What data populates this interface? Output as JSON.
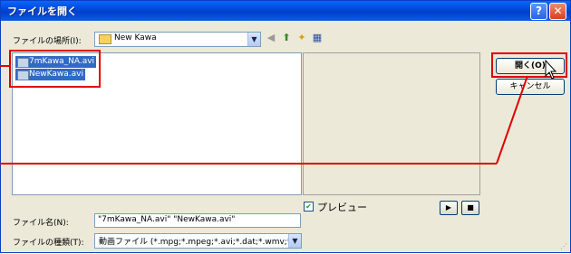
{
  "dialog": {
    "title": "ファイルを開く",
    "help_label": "?",
    "close_label": "✕"
  },
  "location": {
    "label": "ファイルの場所(I):",
    "value": "New Kawa"
  },
  "files": [
    {
      "name": "7mKawa_NA.avi"
    },
    {
      "name": "NewKawa.avi"
    }
  ],
  "buttons": {
    "open": "開く(O)",
    "cancel": "キャンセル"
  },
  "preview": {
    "label": "プレビュー",
    "checked": true
  },
  "filename": {
    "label": "ファイル名(N):",
    "value": "\"7mKawa_NA.avi\" \"NewKawa.avi\""
  },
  "filetype": {
    "label": "ファイルの種類(T):",
    "value": "動画ファイル (*.mpg;*.mpeg;*.avi;*.dat;*.wmv;*.asf;"
  },
  "toolbar": {
    "back_icon": "back-icon",
    "up_icon": "up-folder-icon",
    "new_folder_icon": "new-folder-icon",
    "view_icon": "view-menu-icon"
  },
  "colors": {
    "titlebar": "#0047d6",
    "selection": "#316ac5",
    "annotation": "#e00000"
  }
}
